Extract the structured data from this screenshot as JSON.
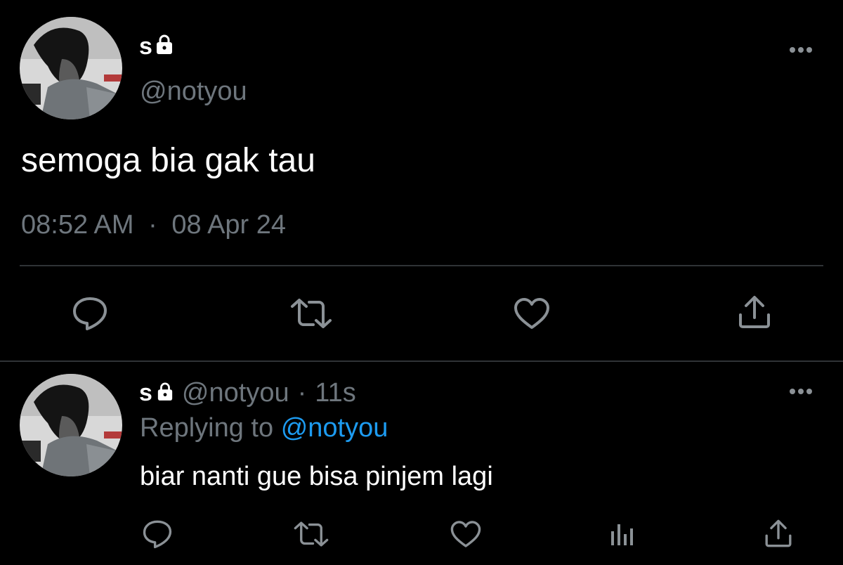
{
  "colors": {
    "background": "#000000",
    "text": "#e7e9ea",
    "muted": "#6e767d",
    "accent": "#1d9bf0",
    "divider": "#2f3336"
  },
  "main_tweet": {
    "display_name": "s",
    "handle": "@notyou",
    "text": "semoga bia gak tau",
    "time": "08:52 AM",
    "separator": "·",
    "date": "08 Apr 24",
    "icons": [
      "lock-icon",
      "more-icon",
      "reply-icon",
      "retweet-icon",
      "like-icon",
      "share-icon"
    ]
  },
  "reply": {
    "display_name": "s",
    "handle": "@notyou",
    "separator": "·",
    "age": "11s",
    "replying_prefix": "Replying to",
    "replying_to": "@notyou",
    "text": "biar nanti gue bisa pinjem lagi",
    "icons": [
      "lock-icon",
      "more-icon",
      "reply-icon",
      "retweet-icon",
      "like-icon",
      "analytics-icon",
      "share-icon"
    ]
  }
}
